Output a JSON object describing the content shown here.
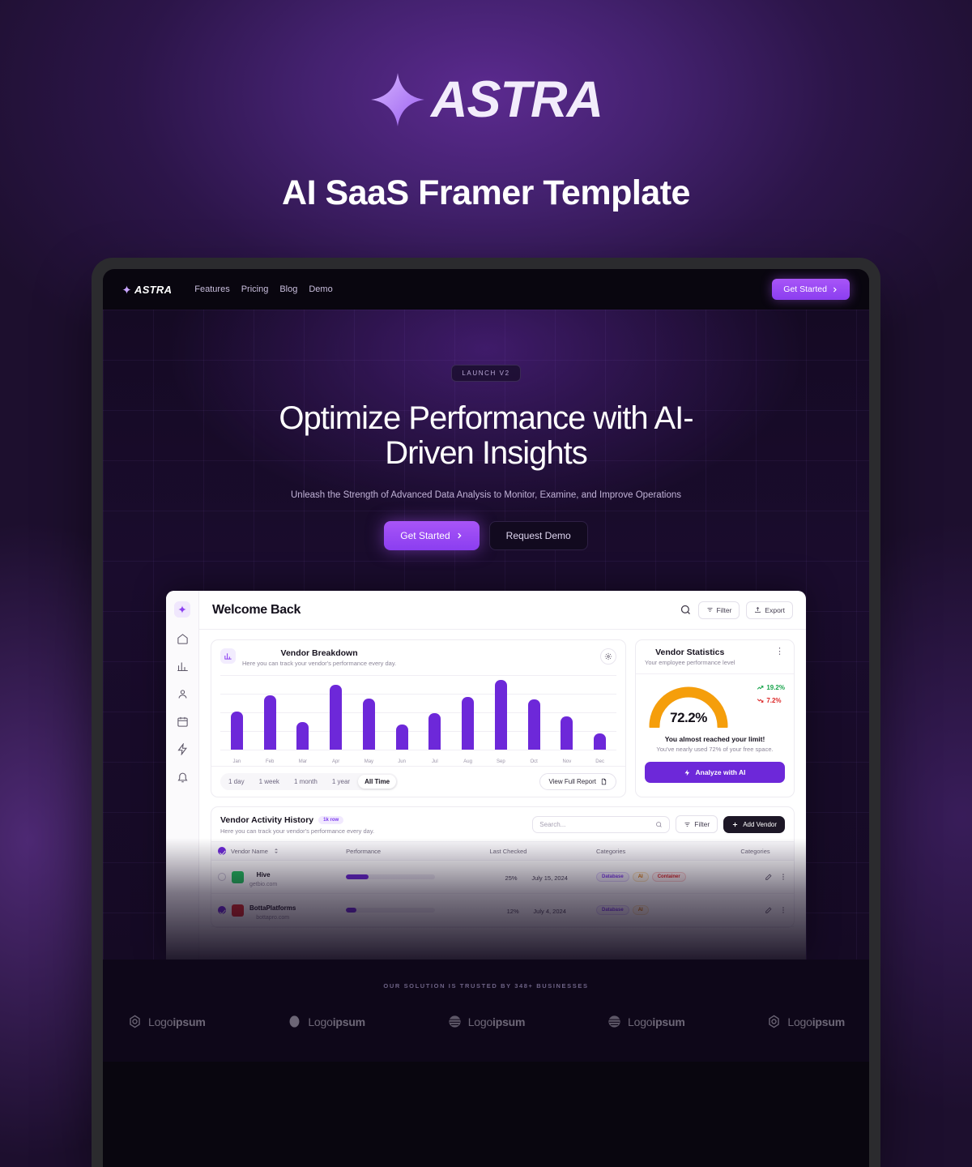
{
  "promo": {
    "brand": "ASTRA",
    "subtitle": "AI SaaS Framer Template"
  },
  "site_nav": {
    "logo": "ASTRA",
    "links": [
      "Features",
      "Pricing",
      "Blog",
      "Demo"
    ],
    "cta": "Get Started"
  },
  "hero": {
    "badge": "LAUNCH V2",
    "title_line1": "Optimize Performance with AI-",
    "title_line2": "Driven Insights",
    "description": "Unleash the Strength of Advanced Data Analysis to Monitor, Examine, and Improve Operations",
    "primary_cta": "Get Started",
    "secondary_cta": "Request Demo"
  },
  "dashboard": {
    "title": "Welcome Back",
    "filter_label": "Filter",
    "export_label": "Export",
    "vendor_breakdown": {
      "title": "Vendor Breakdown",
      "subtitle": "Here you can track your vendor's performance every day.",
      "ranges": [
        "1 day",
        "1 week",
        "1 month",
        "1 year",
        "All Time"
      ],
      "active_range": "All Time",
      "report_button": "View Full Report"
    },
    "vendor_statistics": {
      "title": "Vendor Statistics",
      "subtitle": "Your employee performance level",
      "gauge_value": "72.2%",
      "delta_up": "19.2%",
      "delta_down": "7.2%",
      "alert_title": "You almost reached your limit!",
      "alert_note": "You've nearly used 72% of your free space.",
      "ai_button": "Analyze with AI"
    },
    "activity": {
      "title": "Vendor Activity History",
      "badge": "1k row",
      "subtitle": "Here you can track your vendor's performance every day.",
      "search_placeholder": "Search...",
      "filter_label": "Filter",
      "add_label": "Add Vendor",
      "columns": [
        "Vendor Name",
        "Performance",
        "Last Checked",
        "Categories",
        "Categories"
      ],
      "rows": [
        {
          "selected": false,
          "name": "Hive",
          "site": "getbio.com",
          "performance": 25,
          "performance_label": "25%",
          "last_checked": "July 15, 2024",
          "tags": [
            {
              "label": "Database",
              "color": "purple"
            },
            {
              "label": "AI",
              "color": "amber"
            },
            {
              "label": "Container",
              "color": "red"
            }
          ]
        },
        {
          "selected": true,
          "name": "BottaPlatforms",
          "site": "bottapro.com",
          "performance": 12,
          "performance_label": "12%",
          "last_checked": "July 4, 2024",
          "tags": [
            {
              "label": "Database",
              "color": "purple"
            },
            {
              "label": "AI",
              "color": "amber"
            }
          ]
        }
      ]
    }
  },
  "trusted": {
    "label": "OUR SOLUTION IS TRUSTED BY 348+ BUSINESSES",
    "logos": [
      "Logoipsum",
      "Logoipsum",
      "Logoipsum",
      "Logoipsum",
      "Logoipsum"
    ]
  },
  "chart_data": {
    "type": "bar",
    "title": "Vendor Breakdown",
    "categories": [
      "Jan",
      "Feb",
      "Mar",
      "Apr",
      "May",
      "Jun",
      "Jul",
      "Aug",
      "Sep",
      "Oct",
      "Nov",
      "Dec"
    ],
    "values": [
      52,
      74,
      38,
      88,
      70,
      34,
      50,
      72,
      95,
      68,
      46,
      22
    ],
    "xlabel": "",
    "ylabel": "",
    "ylim": [
      0,
      100
    ],
    "grid": true,
    "legend": "none",
    "bar_color": "#6d28d9"
  },
  "colors": {
    "accent": "#8b3ef0",
    "accent_deep": "#6d28d9",
    "gauge": "#f59e0b",
    "up": "#16a34a",
    "down": "#dc2626"
  }
}
